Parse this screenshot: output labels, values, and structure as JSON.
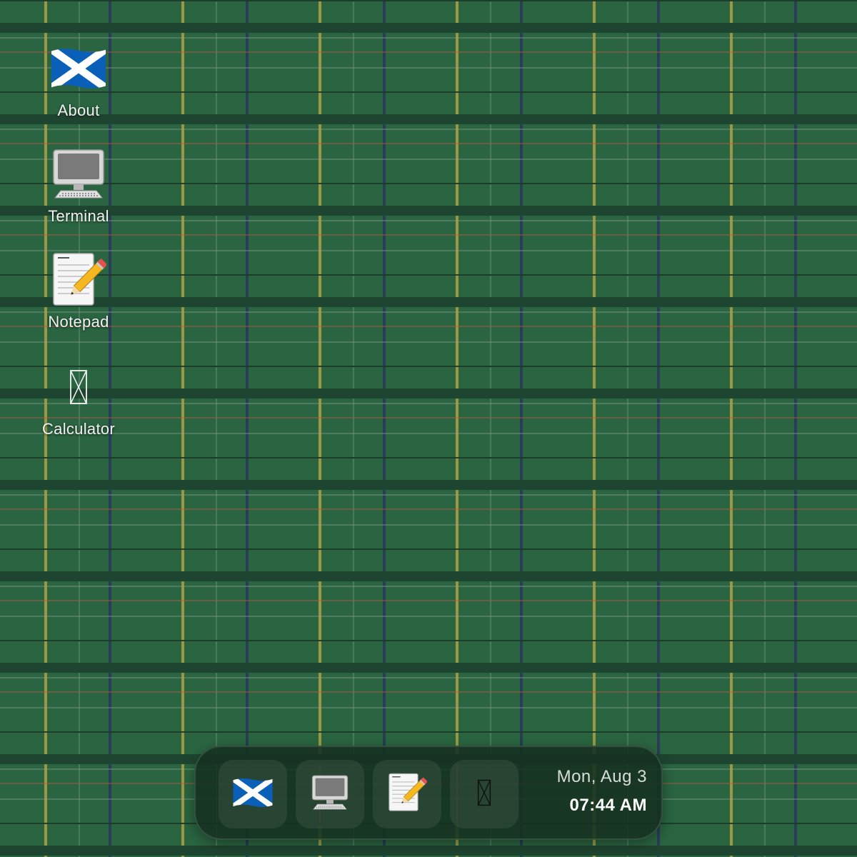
{
  "desktop": {
    "icons": [
      {
        "label": "About",
        "icon": "scotland-flag-icon"
      },
      {
        "label": "Terminal",
        "icon": "computer-monitor-icon"
      },
      {
        "label": "Notepad",
        "icon": "notepad-pencil-icon"
      },
      {
        "label": "Calculator",
        "icon": "missing-glyph-icon"
      }
    ]
  },
  "taskbar": {
    "apps": [
      {
        "icon": "scotland-flag-icon"
      },
      {
        "icon": "computer-monitor-icon"
      },
      {
        "icon": "notepad-pencil-icon"
      },
      {
        "icon": "missing-glyph-icon"
      }
    ],
    "clock": {
      "date": "Mon, Aug 3",
      "time": "07:44 AM"
    }
  },
  "colors": {
    "tartan_green": "#2a6440",
    "tartan_dark": "#1e4530",
    "stripe_yellow": "#bea846",
    "stripe_navy": "#28375a",
    "stripe_red": "#af5a4b",
    "flag_blue": "#0065bd"
  }
}
